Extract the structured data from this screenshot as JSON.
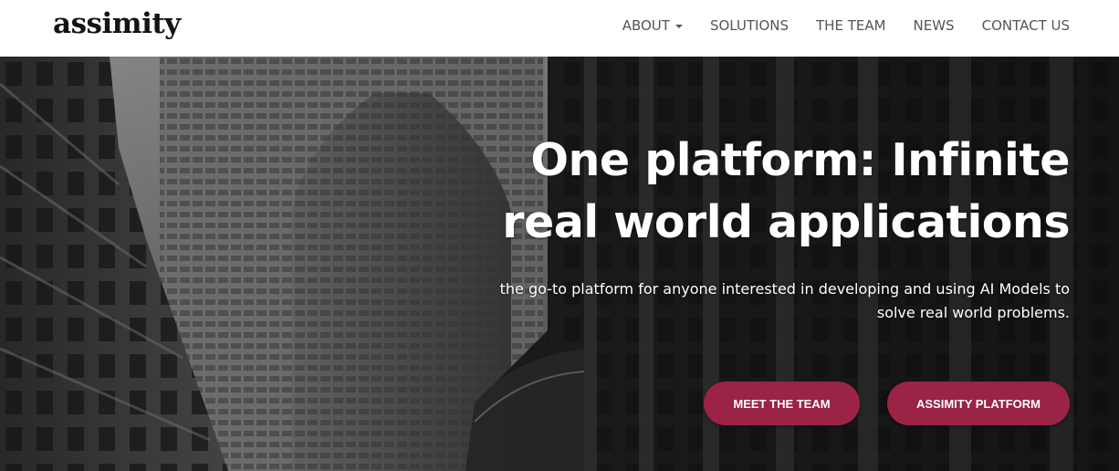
{
  "brand": {
    "logo_text": "assimity"
  },
  "nav": {
    "items": [
      {
        "label": "ABOUT",
        "has_dropdown": true
      },
      {
        "label": "SOLUTIONS"
      },
      {
        "label": "THE TEAM"
      },
      {
        "label": "NEWS"
      },
      {
        "label": "CONTACT US"
      }
    ]
  },
  "hero": {
    "headline_line1": "One platform: Infinite",
    "headline_line2": "real world applications",
    "subtext_line1": "the go-to platform for anyone interested in developing and using AI Models to",
    "subtext_line2": "solve real world problems.",
    "buttons": {
      "meet_team": "MEET THE TEAM",
      "platform": "ASSIMITY PLATFORM"
    },
    "background": "black-and-white city skyscrapers photo"
  },
  "colors": {
    "accent": "#9b2345",
    "nav_text": "#555555",
    "logo": "#141414"
  }
}
